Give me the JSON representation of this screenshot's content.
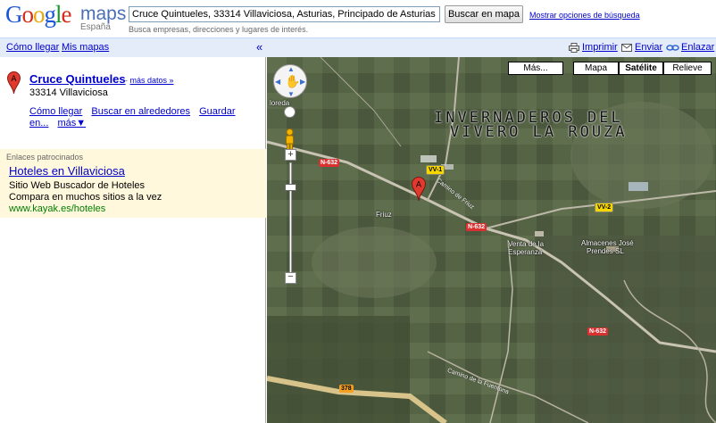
{
  "header": {
    "logo_google": [
      "G",
      "o",
      "o",
      "g",
      "l",
      "e"
    ],
    "logo_maps": "maps",
    "logo_country": "España",
    "search_value": "Cruce Quintueles, 33314 Villaviciosa, Asturias, Principado de Asturias",
    "search_button": "Buscar en mapa",
    "search_options": "Mostrar opciones de búsqueda",
    "search_hint": "Busca empresas, direcciones y lugares de interés."
  },
  "toolbar": {
    "directions": "Cómo llegar",
    "my_maps": "Mis mapas",
    "collapse": "«",
    "print": "Imprimir",
    "send": "Enviar",
    "link": "Enlazar"
  },
  "result": {
    "marker": "A",
    "name": "Cruce Quintueles",
    "more_sep": " - ",
    "more_data": "más datos »",
    "address": "33314 Villaviciosa",
    "actions": [
      "Cómo llegar",
      "Buscar en alrededores",
      "Guardar en...",
      "más▼"
    ]
  },
  "ads": {
    "section_title": "Enlaces patrocinados",
    "link_text": "Hoteles en Villaviciosa",
    "line1": "Sitio Web Buscador de Hoteles",
    "line2": "Compara en muchos sitios a la vez",
    "url": "www.kayak.es/hoteles"
  },
  "map": {
    "types": {
      "more": "Más...",
      "map": "Mapa",
      "satellite": "Satélite",
      "terrain": "Relieve"
    },
    "overlay_line1": "INVERNADEROS DEL",
    "overlay_line2": "VIVERO LA ROUZA",
    "zoom_in": "+",
    "zoom_out": "−",
    "pin_label": "A",
    "road_tags": {
      "n632a": "N-632",
      "n632b": "N-632",
      "n632c": "N-632",
      "vv1": "VV-1",
      "vv2": "VV-2",
      "r378": "378"
    },
    "place_labels": {
      "oreda": "loreda",
      "friuz": "Friuz",
      "venta1": "Venta de la",
      "venta2": "Esperanza",
      "alm1": "Almacenes José",
      "alm2": "Prendes SL"
    },
    "road_labels": {
      "camino_friuz": "Camino de Friuz",
      "camino_fuentona": "Camino de la Fuentona"
    }
  }
}
